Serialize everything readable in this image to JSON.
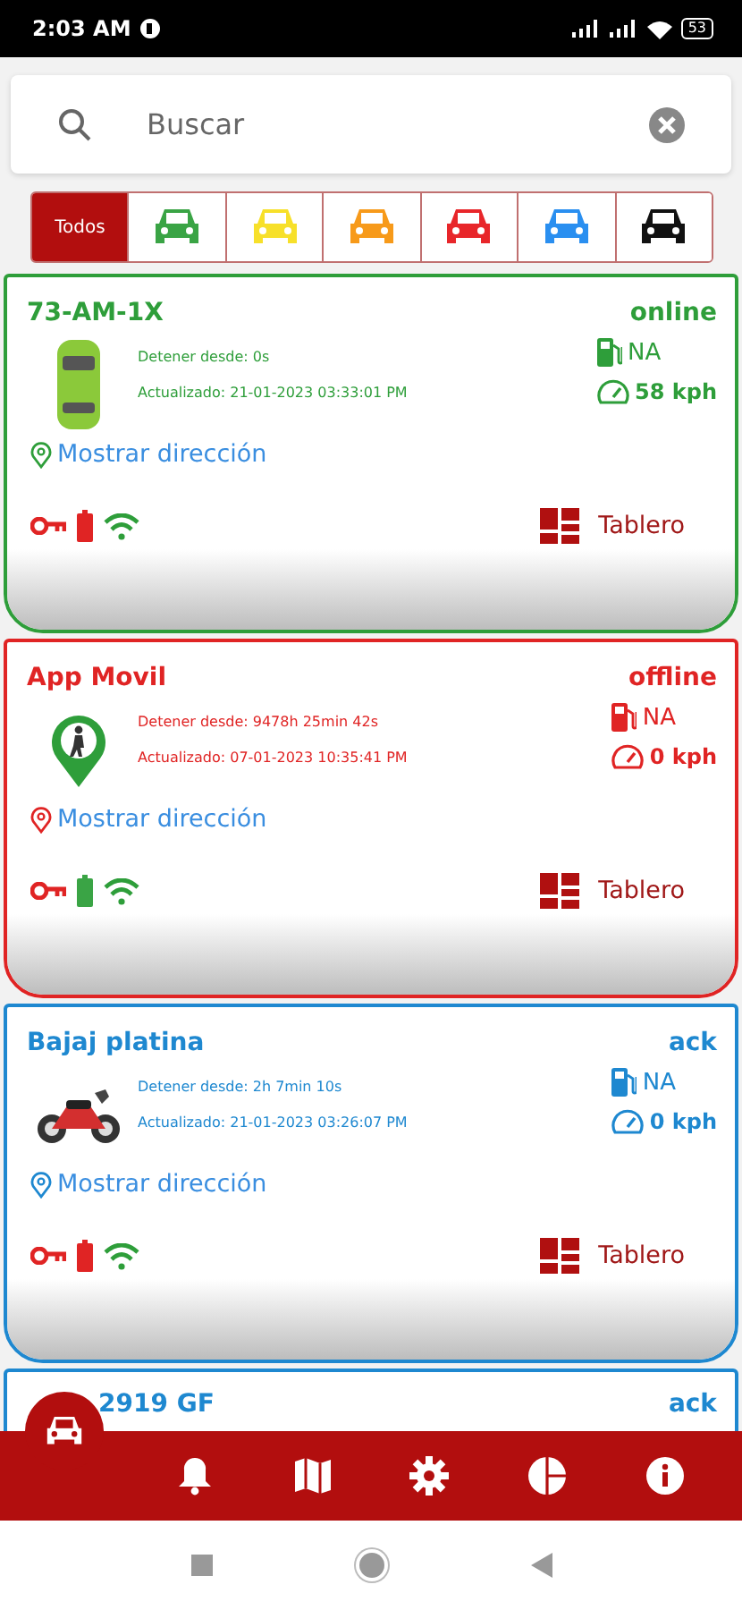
{
  "status_bar": {
    "time": "2:03 AM",
    "battery": "53"
  },
  "search": {
    "placeholder": "Buscar"
  },
  "filters": [
    {
      "kind": "text",
      "label": "Todos",
      "selected": true
    },
    {
      "kind": "car",
      "color": "#3aa445",
      "selected": false
    },
    {
      "kind": "car",
      "color": "#f7e02a",
      "selected": false
    },
    {
      "kind": "car",
      "color": "#f79a1a",
      "selected": false
    },
    {
      "kind": "car",
      "color": "#e8262a",
      "selected": false
    },
    {
      "kind": "car",
      "color": "#2a8ff0",
      "selected": false
    },
    {
      "kind": "car",
      "color": "#111111",
      "selected": false
    }
  ],
  "vehicles": [
    {
      "name": "73-AM-1X",
      "status": "online",
      "color": "#2e9e3a",
      "kind": "car",
      "stopped": "Detener desde: 0s",
      "updated": "Actualizado: 21-01-2023 03:33:01 PM",
      "fuel": "NA",
      "speed": "58 kph",
      "address_link": "Mostrar dirección",
      "battery_ok": false,
      "dashboard": "Tablero"
    },
    {
      "name": "App Movil",
      "status": "offline",
      "color": "#e02424",
      "kind": "person",
      "stopped": "Detener desde: 9478h 25min 42s",
      "updated": "Actualizado: 07-01-2023 10:35:41 PM",
      "fuel": "NA",
      "speed": "0 kph",
      "address_link": "Mostrar dirección",
      "battery_ok": true,
      "dashboard": "Tablero"
    },
    {
      "name": "Bajaj platina",
      "status": "ack",
      "color": "#1e88d0",
      "kind": "moto",
      "stopped": "Detener desde: 2h 7min 10s",
      "updated": "Actualizado: 21-01-2023 03:26:07 PM",
      "fuel": "NA",
      "speed": "0 kph",
      "address_link": "Mostrar dirección",
      "battery_ok": false,
      "dashboard": "Tablero"
    }
  ],
  "next_vehicle": {
    "name": "2919 GF",
    "status": "ack",
    "color": "#1e88d0"
  },
  "bottom_nav": [
    {
      "kind": "car",
      "selected": true
    },
    {
      "kind": "bell",
      "selected": false
    },
    {
      "kind": "map",
      "selected": false
    },
    {
      "kind": "gear",
      "selected": false
    },
    {
      "kind": "chart",
      "selected": false
    },
    {
      "kind": "info",
      "selected": false
    }
  ]
}
